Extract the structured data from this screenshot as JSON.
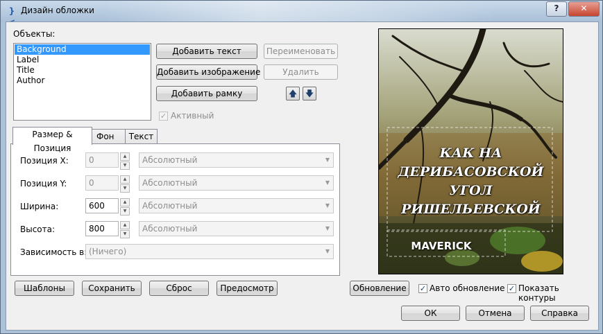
{
  "window": {
    "title": "Дизайн обложки",
    "help_label": "?",
    "close_label": "✕"
  },
  "objects": {
    "label": "Объекты:",
    "items": [
      "Background",
      "Label",
      "Title",
      "Author"
    ],
    "selected": "Background"
  },
  "buttons": {
    "add_text": "Добавить текст",
    "rename": "Переименовать",
    "add_image": "Добавить изображение",
    "delete": "Удалить",
    "add_frame": "Добавить рамку",
    "move_up": "🡅",
    "move_down": "🡇"
  },
  "active_checkbox": {
    "label": "Активный",
    "checked": true
  },
  "tabs": [
    "Размер & Позиция",
    "Фон",
    "Текст"
  ],
  "fields": {
    "pos_x": {
      "label": "Позиция X:",
      "value": "0",
      "mode": "Абсолютный"
    },
    "pos_y": {
      "label": "Позиция Y:",
      "value": "0",
      "mode": "Абсолютный"
    },
    "width": {
      "label": "Ширина:",
      "value": "600",
      "mode": "Абсолютный"
    },
    "height": {
      "label": "Высота:",
      "value": "800",
      "mode": "Абсолютный"
    },
    "dependency": {
      "label": "Зависимость в:",
      "value": "(Ничего)"
    }
  },
  "bottom": {
    "templates": "Шаблоны",
    "save": "Сохранить",
    "reset": "Сброс",
    "preview": "Предосмотр",
    "update": "Обновление",
    "auto_update": "Авто обновление",
    "show_outlines": "Показать контуры",
    "ok": "ОК",
    "cancel": "Отмена",
    "help": "Справка"
  },
  "cover": {
    "title_lines": [
      "КАК НА",
      "ДЕРИБАСОВСКОЙ",
      "УГОЛ",
      "РИШЕЛЬЕВСКОЙ"
    ],
    "author": "MAVERICK"
  }
}
